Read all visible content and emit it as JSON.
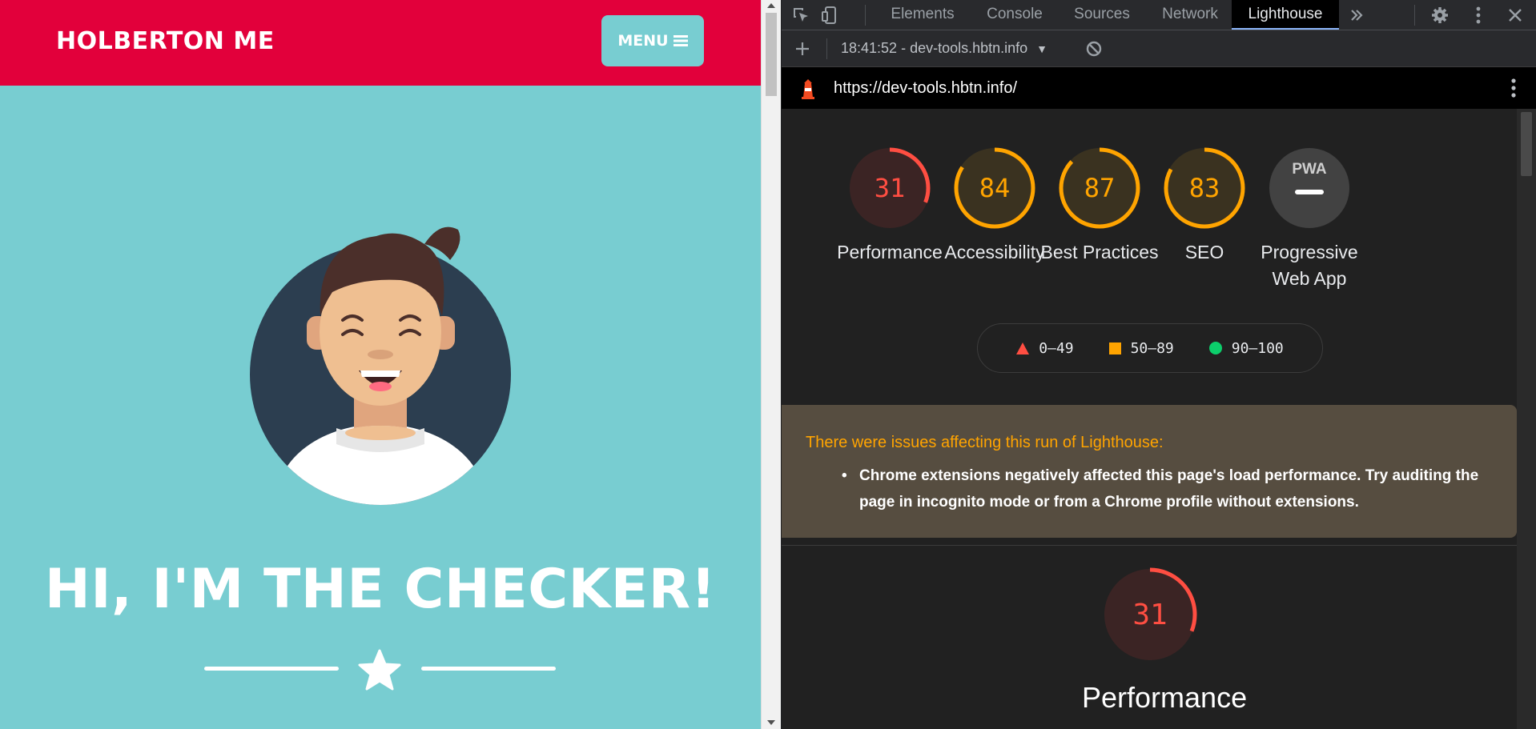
{
  "site": {
    "brand": "HOLBERTON ME",
    "menu_label": "MENU",
    "hero_title": "HI, I'M THE CHECKER!"
  },
  "devtools": {
    "tabs": [
      {
        "label": "Elements",
        "active": false
      },
      {
        "label": "Console",
        "active": false
      },
      {
        "label": "Sources",
        "active": false
      },
      {
        "label": "Network",
        "active": false
      },
      {
        "label": "Lighthouse",
        "active": true
      }
    ],
    "run_label": "18:41:52 - dev-tools.hbtn.info",
    "url": "https://dev-tools.hbtn.info/"
  },
  "gauges": [
    {
      "label": "Performance",
      "score": 31,
      "color": "#ff4e42",
      "bg": "#3b2424"
    },
    {
      "label": "Accessibility",
      "score": 84,
      "color": "#ffa400",
      "bg": "#3a3220"
    },
    {
      "label": "Best Practices",
      "score": 87,
      "color": "#ffa400",
      "bg": "#3a3220"
    },
    {
      "label": "SEO",
      "score": 83,
      "color": "#ffa400",
      "bg": "#3a3220"
    },
    {
      "label": "Progressive Web App",
      "badge": "PWA",
      "color": "#ffffff",
      "bg": "#424242"
    }
  ],
  "legend": [
    {
      "range": "0–49",
      "shape": "triangle",
      "color": "#ff4e42"
    },
    {
      "range": "50–89",
      "shape": "square",
      "color": "#ffa400"
    },
    {
      "range": "90–100",
      "shape": "circle",
      "color": "#0cce6b"
    }
  ],
  "warning": {
    "title": "There were issues affecting this run of Lighthouse:",
    "item": "Chrome extensions negatively affected this page's load performance. Try auditing the page in incognito mode or from a Chrome profile without extensions."
  },
  "section": {
    "label": "Performance",
    "score": 31,
    "color": "#ff4e42"
  }
}
